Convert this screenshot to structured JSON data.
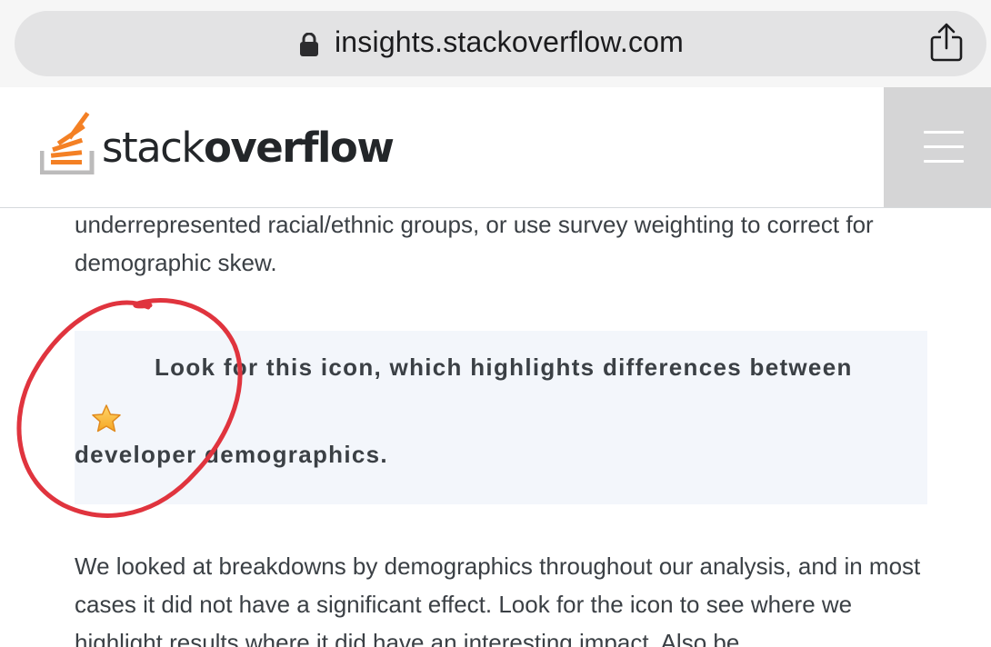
{
  "browser": {
    "url": "insights.stackoverflow.com",
    "lock_icon": "lock-icon",
    "share_icon": "share-icon"
  },
  "header": {
    "logo_regular": "stack",
    "logo_bold": "overflow",
    "menu_icon": "hamburger-menu-icon"
  },
  "article": {
    "paragraph_1": "underrepresented racial/ethnic groups, or use survey weighting to correct for demographic skew.",
    "callout": {
      "line_1": "Look for this icon, which highlights differences between",
      "line_2": "developer demographics.",
      "icon": "star-icon"
    },
    "paragraph_2": "We looked at breakdowns by demographics throughout our analysis, and in most cases it did not have a significant effect. Look for the icon to see where we highlight results where it did have an interesting impact. Also be"
  },
  "colors": {
    "brand_orange": "#f48024",
    "annotation_red": "#e0343e",
    "callout_background": "#f3f6fb",
    "text": "#3b4045"
  }
}
